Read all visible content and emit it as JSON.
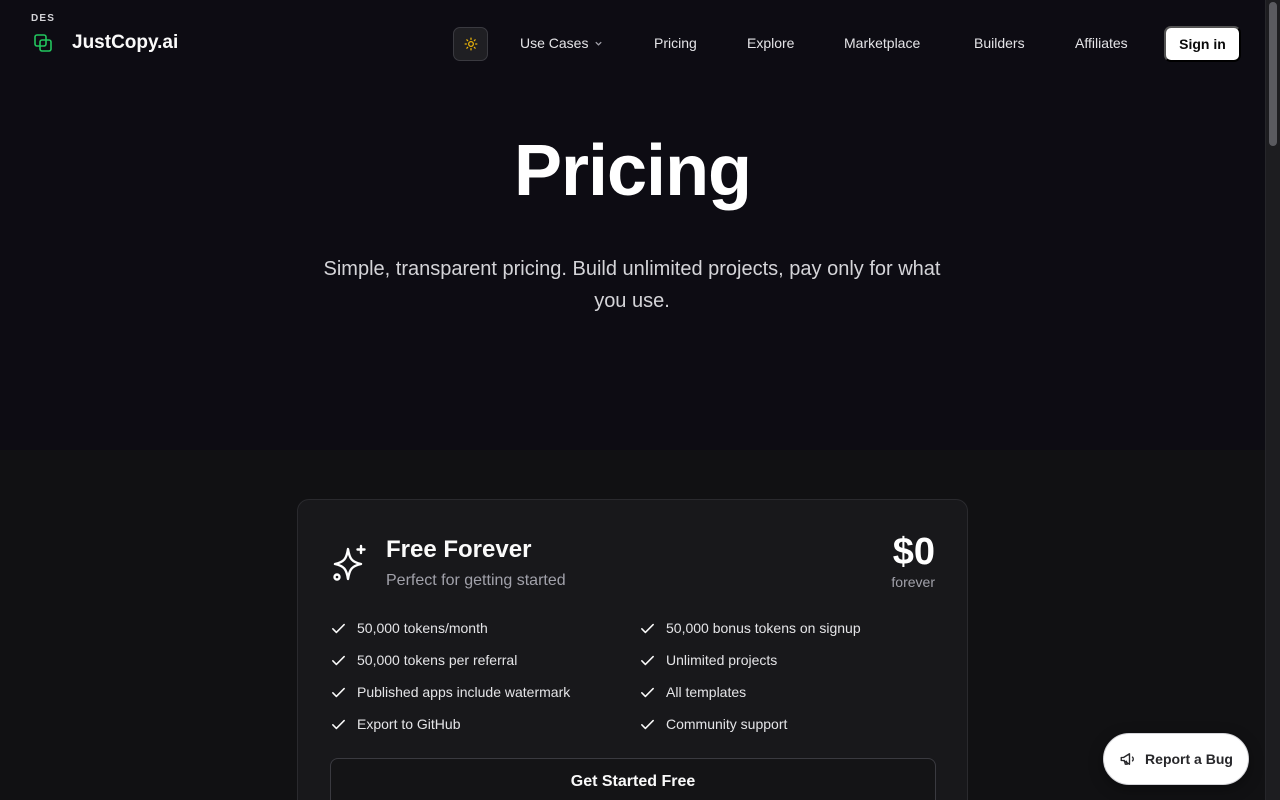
{
  "header": {
    "env_badge": "DES",
    "logo_text": "JustCopy.ai",
    "nav": [
      {
        "label": "Use Cases",
        "has_dropdown": true
      },
      {
        "label": "Pricing"
      },
      {
        "label": "Explore"
      },
      {
        "label": "Marketplace"
      },
      {
        "label": "Builders"
      },
      {
        "label": "Affiliates"
      }
    ],
    "signin_label": "Sign in",
    "theme_icon": "sun-icon"
  },
  "hero": {
    "title": "Pricing",
    "subtitle": "Simple, transparent pricing. Build unlimited projects, pay only for what you use."
  },
  "plan": {
    "icon": "sparkles-icon",
    "name": "Free Forever",
    "description": "Perfect for getting started",
    "price": "$0",
    "period": "forever",
    "features_left": [
      "50,000 tokens/month",
      "50,000 tokens per referral",
      "Published apps include watermark",
      "Export to GitHub"
    ],
    "features_right": [
      "50,000 bonus tokens on signup",
      "Unlimited projects",
      "All templates",
      "Community support"
    ],
    "cta_label": "Get Started Free"
  },
  "bug_button": {
    "label": "Report a Bug",
    "icon": "megaphone-icon"
  },
  "colors": {
    "accent_green": "#22c55e",
    "sun_yellow": "#eab308"
  }
}
